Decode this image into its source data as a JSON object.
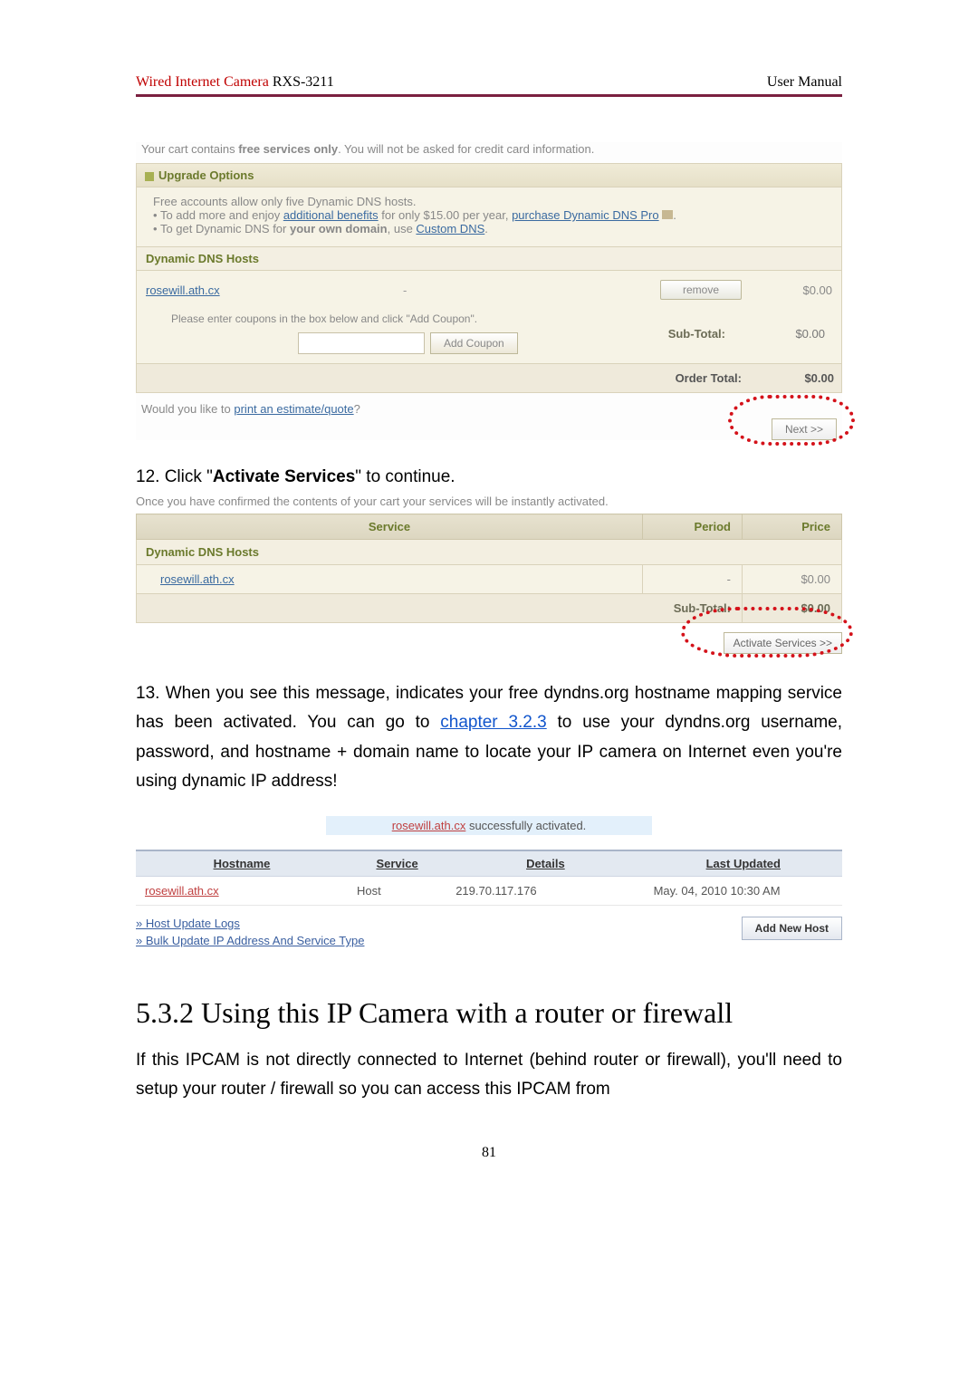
{
  "header": {
    "left_dev": "Wired Internet Camera",
    "left_model": " RXS-3211",
    "right": "User Manual"
  },
  "cart_note": {
    "pre": "Your cart contains ",
    "bold": "free services only",
    "post": ". You will not be asked for credit card information."
  },
  "upgrade": {
    "title": "Upgrade Options",
    "line1": "Free accounts allow only five Dynamic DNS hosts.",
    "line2a": "To add more and enjoy ",
    "line2_link1": "additional benefits",
    "line2b": " for only $15.00 per year, ",
    "line2_link2": "purchase Dynamic DNS Pro",
    "line2c": ".",
    "line3a": "To get Dynamic DNS for ",
    "line3_bold": "your own domain",
    "line3b": ", use ",
    "line3_link": "Custom DNS",
    "line3c": "."
  },
  "hosts_section": {
    "title": "Dynamic DNS Hosts",
    "host": "rosewill.ath.cx",
    "dash": "-",
    "remove": "remove",
    "price": "$0.00"
  },
  "coupon": {
    "label": "Please enter coupons in the box below and click \"Add Coupon\".",
    "add": "Add Coupon"
  },
  "subtotal": {
    "label": "Sub-Total:",
    "value": "$0.00"
  },
  "ordertotal": {
    "label": "Order Total:",
    "value": "$0.00"
  },
  "estimate": {
    "pre": "Would you like to ",
    "link": "print an estimate/quote",
    "post": "?"
  },
  "next_btn": "Next >>",
  "step12": {
    "pre": "12. Click \"",
    "bold": "Activate Services",
    "post": "\" to continue."
  },
  "confirm_note": "Once you have confirmed the contents of your cart your services will be instantly activated.",
  "svc_table": {
    "h_service": "Service",
    "h_period": "Period",
    "h_price": "Price",
    "cat": "Dynamic DNS Hosts",
    "row_host": "rosewill.ath.cx",
    "row_period": "-",
    "row_price": "$0.00",
    "sub_label": "Sub-Total:",
    "sub_value": "$0.00"
  },
  "activate_btn": "Activate Services >>",
  "step13": {
    "text_a": "13. When you see this message, indicates your free dyndns.org hostname mapping service has been activated. You can go to ",
    "link": "chapter 3.2.3",
    "text_b": " to use your dyndns.org username, password, and hostname + domain name to locate your IP camera on Internet even you're using dynamic IP address!"
  },
  "success": {
    "host": "rosewill.ath.cx",
    "msg": " successfully activated."
  },
  "listing": {
    "h_host": "Hostname",
    "h_service": "Service",
    "h_details": "Details",
    "h_updated": "Last Updated",
    "row_host": "rosewill.ath.cx",
    "row_service": "Host",
    "row_details": "219.70.117.176",
    "row_updated": "May. 04, 2010 10:30 AM"
  },
  "host_links": {
    "l1": "» Host Update Logs",
    "l2": "» Bulk Update IP Address And Service Type",
    "add": "Add New Host"
  },
  "sec532": "5.3.2 Using this IP Camera with a router or firewall",
  "para532": "If this IPCAM is not directly connected to Internet (behind router or firewall), you'll need to setup your router / firewall so you can access this IPCAM from",
  "pagenum": "81"
}
